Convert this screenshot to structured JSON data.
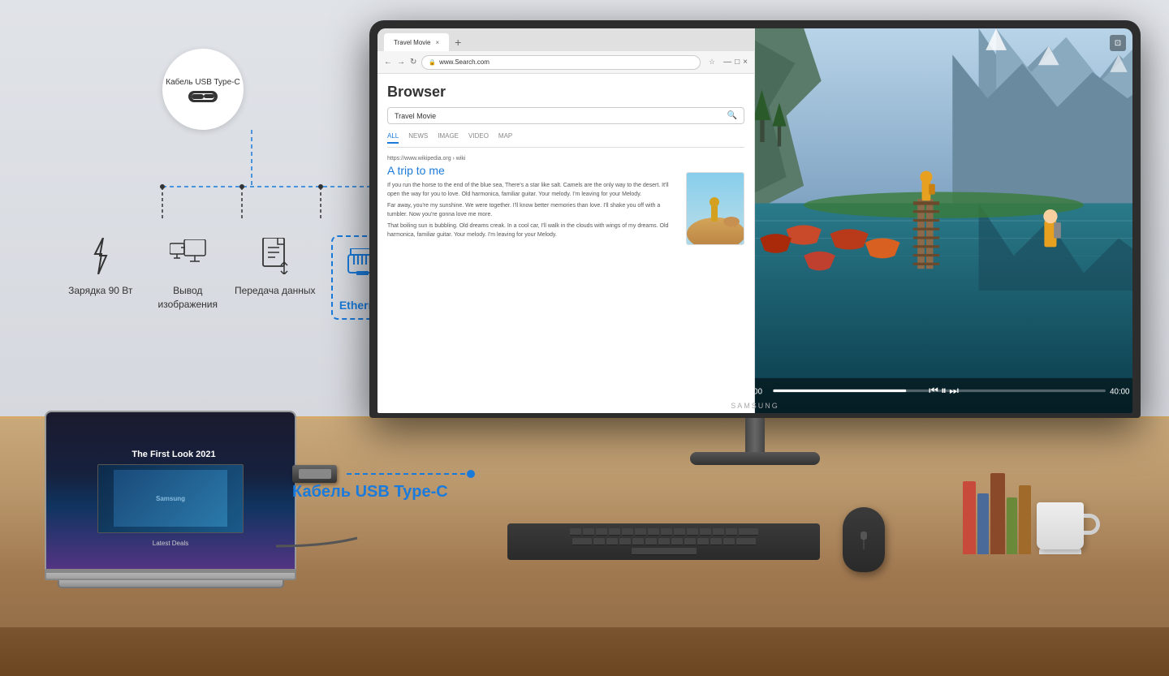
{
  "background": {
    "wall_color": "#dde1e6",
    "desk_color": "#c9a87a"
  },
  "left_panel": {
    "usb_badge": {
      "label": "Кабель\nUSB Type-C"
    },
    "features": [
      {
        "id": "charging",
        "icon": "lightning",
        "label": "Зарядка\n90 Вт"
      },
      {
        "id": "display",
        "icon": "monitor",
        "label": "Вывод\nизображения"
      },
      {
        "id": "data",
        "icon": "document",
        "label": "Передача\nданных"
      },
      {
        "id": "ethernet",
        "icon": "ethernet",
        "label": "Ethernet",
        "highlighted": true
      }
    ],
    "cable_label": "Кабель USB Type-C"
  },
  "browser": {
    "tab_title": "Travel Movie",
    "url": "www.Search.com",
    "title": "Browser",
    "search_text": "Travel Movie",
    "nav_items": [
      "ALL",
      "NEWS",
      "IMAGE",
      "VIDEO",
      "MAP"
    ],
    "result": {
      "url": "https://www.wikipedia.org › wiki",
      "title": "A trip to me",
      "paragraphs": [
        "If you run the horse to the end of the blue sea, There's a star like salt. Camels are the only way to the desert. It'll open the way for you to love. Old harmonica, familiar guitar. Your melody. I'm leaving for your Melody.",
        "Far away, you're my sunshine. We were together. I'll know better memories than love. I'll shake you off with a tumbler. Now you're gonna love me more.",
        "That boiling sun is bubbling. Old dreams creak. In a cool car, I'll walk in the clouds with wings of my dreams. Old harmonica, familiar guitar. Your melody. I'm leaving for your Melody."
      ]
    }
  },
  "monitor": {
    "brand": "SAMSUNG",
    "stand": true
  },
  "laptop": {
    "brand": "SAMSUNG",
    "screen_content": "The First Look 2021",
    "deals_text": "Latest Deals"
  },
  "desk_items": {
    "keyboard": true,
    "mouse": true,
    "cup": true,
    "books": [
      "#c84a3a",
      "#4a6a9a",
      "#8a4a2a",
      "#6a8a3a",
      "#a06a2a"
    ]
  }
}
